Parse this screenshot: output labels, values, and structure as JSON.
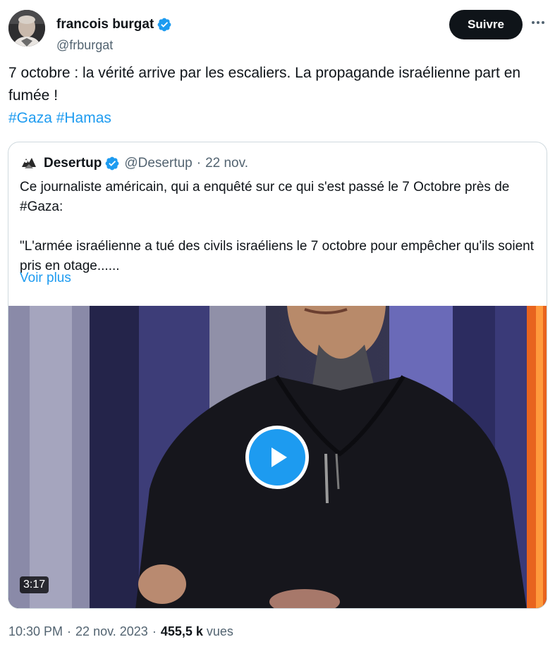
{
  "author": {
    "name": "francois burgat",
    "handle": "@frburgat"
  },
  "actions": {
    "follow_label": "Suivre"
  },
  "tweet": {
    "text": "7 octobre : la vérité arrive par les escaliers. La propagande israélienne part en fumée !",
    "hashtags": "#Gaza #Hamas"
  },
  "quote": {
    "name": "Desertup",
    "handle": "@Desertup",
    "separator": "·",
    "date": "22 nov.",
    "text_line1": "Ce journaliste américain, qui a enquêté sur ce qui s'est passé le 7 Octobre près de #Gaza:",
    "text_line2": "\"L'armée israélienne a tué des civils israéliens le 7 octobre pour empêcher qu'ils soient pris en otage......",
    "show_more": "Voir plus",
    "video_duration": "3:17"
  },
  "meta": {
    "time": "10:30 PM",
    "separator": "·",
    "date": "22 nov. 2023",
    "views_count": "455,5 k",
    "views_label": "vues"
  },
  "colors": {
    "accent": "#1d9bf0",
    "text": "#0f1419",
    "secondary": "#536471",
    "border": "#cfd9de"
  },
  "icons": {
    "verified": "verified-badge-icon",
    "more": "more-dots-icon",
    "play": "play-icon"
  }
}
